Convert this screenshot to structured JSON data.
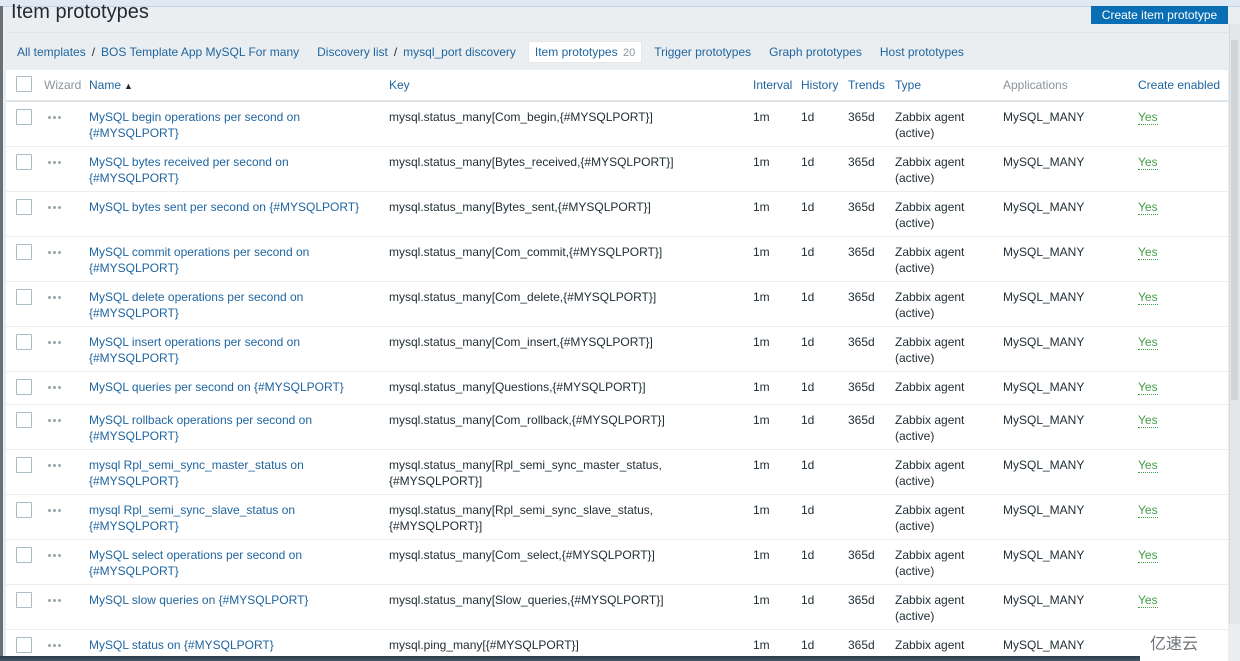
{
  "header": {
    "title": "Item prototypes",
    "create_button": "Create item prototype"
  },
  "breadcrumbs": {
    "all_templates": "All templates",
    "template": "BOS Template App MySQL For many",
    "discovery_list": "Discovery list",
    "discovery_rule": "mysql_port discovery",
    "separator": "/"
  },
  "tabs": [
    {
      "label": "Item prototypes",
      "count": "20",
      "active": true
    },
    {
      "label": "Trigger prototypes"
    },
    {
      "label": "Graph prototypes"
    },
    {
      "label": "Host prototypes"
    }
  ],
  "table": {
    "columns": {
      "wizard": "Wizard",
      "name": "Name",
      "key": "Key",
      "interval": "Interval",
      "history": "History",
      "trends": "Trends",
      "type": "Type",
      "applications": "Applications",
      "create_enabled": "Create enabled"
    },
    "sort_indicator": "▲",
    "rows": [
      {
        "name": "MySQL begin operations per second on {#MYSQLPORT}",
        "key": "mysql.status_many[Com_begin,{#MYSQLPORT}]",
        "interval": "1m",
        "history": "1d",
        "trends": "365d",
        "type": "Zabbix agent (active)",
        "applications": "MySQL_MANY",
        "create_enabled": "Yes"
      },
      {
        "name": "MySQL bytes received per second on {#MYSQLPORT}",
        "key": "mysql.status_many[Bytes_received,{#MYSQLPORT}]",
        "interval": "1m",
        "history": "1d",
        "trends": "365d",
        "type": "Zabbix agent (active)",
        "applications": "MySQL_MANY",
        "create_enabled": "Yes"
      },
      {
        "name": "MySQL bytes sent per second on {#MYSQLPORT}",
        "key": "mysql.status_many[Bytes_sent,{#MYSQLPORT}]",
        "interval": "1m",
        "history": "1d",
        "trends": "365d",
        "type": "Zabbix agent (active)",
        "applications": "MySQL_MANY",
        "create_enabled": "Yes"
      },
      {
        "name": "MySQL commit operations per second on {#MYSQLPORT}",
        "key": "mysql.status_many[Com_commit,{#MYSQLPORT}]",
        "interval": "1m",
        "history": "1d",
        "trends": "365d",
        "type": "Zabbix agent (active)",
        "applications": "MySQL_MANY",
        "create_enabled": "Yes"
      },
      {
        "name": "MySQL delete operations per second on {#MYSQLPORT}",
        "key": "mysql.status_many[Com_delete,{#MYSQLPORT}]",
        "interval": "1m",
        "history": "1d",
        "trends": "365d",
        "type": "Zabbix agent (active)",
        "applications": "MySQL_MANY",
        "create_enabled": "Yes"
      },
      {
        "name": "MySQL insert operations per second on {#MYSQLPORT}",
        "key": "mysql.status_many[Com_insert,{#MYSQLPORT}]",
        "interval": "1m",
        "history": "1d",
        "trends": "365d",
        "type": "Zabbix agent (active)",
        "applications": "MySQL_MANY",
        "create_enabled": "Yes"
      },
      {
        "name": "MySQL queries per second on {#MYSQLPORT}",
        "key": "mysql.status_many[Questions,{#MYSQLPORT}]",
        "interval": "1m",
        "history": "1d",
        "trends": "365d",
        "type": "Zabbix agent",
        "applications": "MySQL_MANY",
        "create_enabled": "Yes"
      },
      {
        "name": "MySQL rollback operations per second on {#MYSQLPORT}",
        "key": "mysql.status_many[Com_rollback,{#MYSQLPORT}]",
        "interval": "1m",
        "history": "1d",
        "trends": "365d",
        "type": "Zabbix agent (active)",
        "applications": "MySQL_MANY",
        "create_enabled": "Yes"
      },
      {
        "name": "mysql Rpl_semi_sync_master_status on {#MYSQLPORT}",
        "key": "mysql.status_many[Rpl_semi_sync_master_status, {#MYSQLPORT}]",
        "interval": "1m",
        "history": "1d",
        "trends": "",
        "type": "Zabbix agent (active)",
        "applications": "MySQL_MANY",
        "create_enabled": "Yes"
      },
      {
        "name": "mysql Rpl_semi_sync_slave_status on {#MYSQLPORT}",
        "key": "mysql.status_many[Rpl_semi_sync_slave_status, {#MYSQLPORT}]",
        "interval": "1m",
        "history": "1d",
        "trends": "",
        "type": "Zabbix agent (active)",
        "applications": "MySQL_MANY",
        "create_enabled": "Yes"
      },
      {
        "name": "MySQL select operations per second on {#MYSQLPORT}",
        "key": "mysql.status_many[Com_select,{#MYSQLPORT}]",
        "interval": "1m",
        "history": "1d",
        "trends": "365d",
        "type": "Zabbix agent (active)",
        "applications": "MySQL_MANY",
        "create_enabled": "Yes"
      },
      {
        "name": "MySQL slow queries on {#MYSQLPORT}",
        "key": "mysql.status_many[Slow_queries,{#MYSQLPORT}]",
        "interval": "1m",
        "history": "1d",
        "trends": "365d",
        "type": "Zabbix agent (active)",
        "applications": "MySQL_MANY",
        "create_enabled": "Yes"
      },
      {
        "name": "MySQL status on {#MYSQLPORT}",
        "key": "mysql.ping_many[{#MYSQLPORT}]",
        "interval": "1m",
        "history": "1d",
        "trends": "365d",
        "type": "Zabbix agent (active)",
        "applications": "MySQL_MANY",
        "create_enabled": ""
      }
    ]
  },
  "watermark": "亿速云",
  "colors": {
    "link": "#1f65a0",
    "enabled": "#429e47",
    "primary_button": "#0a6eb4"
  }
}
